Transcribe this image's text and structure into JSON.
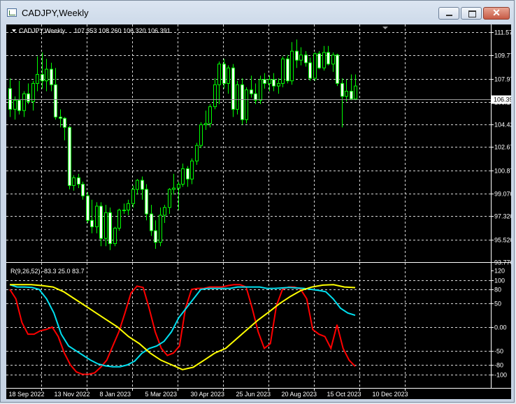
{
  "window": {
    "title": "CADJPY,Weekly",
    "close_glyph": "✕"
  },
  "main_header": {
    "symbol": "CADJPY,Weekly",
    "ohlc": "107.353 108.260 106.320 106.391"
  },
  "indicator_header": {
    "text": "R(9,26,52) -83.3 25.0 83.7"
  },
  "current_price": "106.391",
  "colors": {
    "candle": "#00ff00",
    "grid": "#d8d8d8",
    "background": "#000000",
    "red_line": "#ff0000",
    "yellow_line": "#ffff00",
    "cyan_line": "#00e0f0"
  },
  "icons": [
    "chart-window-icon",
    "minimize-icon",
    "maximize-icon",
    "close-icon",
    "dropdown-triangle-icon"
  ],
  "chart_data": [
    {
      "type": "candlestick",
      "y_ticks": [
        "111.570",
        "109.770",
        "107.970",
        "106.170",
        "104.420",
        "102.670",
        "100.870",
        "99.070",
        "97.320",
        "95.520",
        "93.770"
      ],
      "ylim": [
        93.77,
        111.57
      ],
      "x_ticks": [
        "18 Sep 2022",
        "13 Nov 2022",
        "8 Jan 2023",
        "5 Mar 2023",
        "30 Apr 2023",
        "25 Jun 2023",
        "20 Aug 2023",
        "15 Oct 2023",
        "10 Dec 2023"
      ],
      "grid": true,
      "candles": [
        [
          107.2,
          108.0,
          105.0,
          105.6
        ],
        [
          105.6,
          106.6,
          104.8,
          106.3
        ],
        [
          106.3,
          107.8,
          105.2,
          105.5
        ],
        [
          105.5,
          107.0,
          105.0,
          106.8
        ],
        [
          106.8,
          107.6,
          106.0,
          106.2
        ],
        [
          106.2,
          107.8,
          105.5,
          107.6
        ],
        [
          107.6,
          109.7,
          107.0,
          108.3
        ],
        [
          108.3,
          110.0,
          107.2,
          107.8
        ],
        [
          107.8,
          109.5,
          107.0,
          108.7
        ],
        [
          108.7,
          109.2,
          107.0,
          107.5
        ],
        [
          107.5,
          108.8,
          104.8,
          105.0
        ],
        [
          105.0,
          105.6,
          104.2,
          104.9
        ],
        [
          104.9,
          105.0,
          103.2,
          104.2
        ],
        [
          104.2,
          104.3,
          99.4,
          99.7
        ],
        [
          99.7,
          100.5,
          99.3,
          100.3
        ],
        [
          100.3,
          100.6,
          99.5,
          99.8
        ],
        [
          99.8,
          100.0,
          98.6,
          98.9
        ],
        [
          98.9,
          99.2,
          96.8,
          97.0
        ],
        [
          97.0,
          98.6,
          96.0,
          96.5
        ],
        [
          96.5,
          98.4,
          96.0,
          98.1
        ],
        [
          98.1,
          98.4,
          95.0,
          95.6
        ],
        [
          95.6,
          98.2,
          95.0,
          97.6
        ],
        [
          97.6,
          98.0,
          94.7,
          95.2
        ],
        [
          95.2,
          96.5,
          95.0,
          96.4
        ],
        [
          96.4,
          97.9,
          96.2,
          97.8
        ],
        [
          97.8,
          98.3,
          97.5,
          97.8
        ],
        [
          97.8,
          98.6,
          97.4,
          98.3
        ],
        [
          98.3,
          99.7,
          98.0,
          99.4
        ],
        [
          99.4,
          100.2,
          99.0,
          100.1
        ],
        [
          100.1,
          100.4,
          98.6,
          99.4
        ],
        [
          99.4,
          99.8,
          97.0,
          97.5
        ],
        [
          97.5,
          98.2,
          95.8,
          96.2
        ],
        [
          96.2,
          97.0,
          94.8,
          95.3
        ],
        [
          95.3,
          98.0,
          95.0,
          97.4
        ],
        [
          97.4,
          98.2,
          96.8,
          98.0
        ],
        [
          98.0,
          99.5,
          97.5,
          99.4
        ],
        [
          99.4,
          100.6,
          99.0,
          99.5
        ],
        [
          99.5,
          100.0,
          97.8,
          99.8
        ],
        [
          99.8,
          101.4,
          99.6,
          101.0
        ],
        [
          101.0,
          101.2,
          99.6,
          100.2
        ],
        [
          100.2,
          101.8,
          99.8,
          101.6
        ],
        [
          101.6,
          103.0,
          101.3,
          102.8
        ],
        [
          102.8,
          104.6,
          102.6,
          104.4
        ],
        [
          104.4,
          105.5,
          104.0,
          104.5
        ],
        [
          104.5,
          106.0,
          104.2,
          105.8
        ],
        [
          105.8,
          108.0,
          105.6,
          107.5
        ],
        [
          107.5,
          109.3,
          106.0,
          109.1
        ],
        [
          109.1,
          109.5,
          107.2,
          107.6
        ],
        [
          107.6,
          109.0,
          106.8,
          108.8
        ],
        [
          108.8,
          109.1,
          105.0,
          105.6
        ],
        [
          105.6,
          107.8,
          105.2,
          107.5
        ],
        [
          107.5,
          108.0,
          104.4,
          104.8
        ],
        [
          104.8,
          107.3,
          104.5,
          107.1
        ],
        [
          107.1,
          108.2,
          106.5,
          106.8
        ],
        [
          106.8,
          107.6,
          106.0,
          106.3
        ],
        [
          106.3,
          108.2,
          106.0,
          107.9
        ],
        [
          107.9,
          108.4,
          107.2,
          107.6
        ],
        [
          107.6,
          108.2,
          107.0,
          107.9
        ],
        [
          107.9,
          108.4,
          107.0,
          107.4
        ],
        [
          107.4,
          108.0,
          106.8,
          107.6
        ],
        [
          107.6,
          109.7,
          107.3,
          109.5
        ],
        [
          109.5,
          109.8,
          107.6,
          107.8
        ],
        [
          107.8,
          110.8,
          107.5,
          110.1
        ],
        [
          110.1,
          111.0,
          108.8,
          109.4
        ],
        [
          109.4,
          110.4,
          109.0,
          109.8
        ],
        [
          109.8,
          110.1,
          108.9,
          109.2
        ],
        [
          109.2,
          109.6,
          107.8,
          108.0
        ],
        [
          108.0,
          110.0,
          107.8,
          109.9
        ],
        [
          109.9,
          110.1,
          108.7,
          108.8
        ],
        [
          108.8,
          110.5,
          108.6,
          110.0
        ],
        [
          110.0,
          110.5,
          109.0,
          109.1
        ],
        [
          109.1,
          110.0,
          108.5,
          109.8
        ],
        [
          109.8,
          109.9,
          107.4,
          107.6
        ],
        [
          107.6,
          108.0,
          104.2,
          106.6
        ],
        [
          106.6,
          107.9,
          106.2,
          107.0
        ],
        [
          107.0,
          108.3,
          106.3,
          106.4
        ],
        [
          106.4,
          108.3,
          106.3,
          107.4
        ]
      ]
    },
    {
      "type": "line",
      "header": "R(9,26,52) -83.3 25.0 83.7",
      "y_ticks": [
        "120",
        "100",
        "80",
        "50",
        "0.00",
        "-50",
        "-80",
        "-100"
      ],
      "ylim": [
        -120,
        120
      ],
      "x_ticks": [
        "18 Sep 2022",
        "13 Nov 2022",
        "8 Jan 2023",
        "5 Mar 2023",
        "30 Apr 2023",
        "25 Jun 2023",
        "20 Aug 2023",
        "15 Oct 2023",
        "10 Dec 2023"
      ],
      "series": [
        {
          "color": "#ff0000",
          "values": [
            80,
            60,
            10,
            -15,
            -15,
            -8,
            -5,
            0,
            -20,
            -55,
            -80,
            -95,
            -100,
            -100,
            -97,
            -85,
            -70,
            -40,
            -10,
            30,
            72,
            87,
            84,
            40,
            -10,
            -45,
            -60,
            -55,
            -40,
            40,
            80,
            82,
            82,
            85,
            85,
            85,
            88,
            90,
            90,
            85,
            40,
            -10,
            -45,
            -35,
            45,
            80,
            85,
            85,
            80,
            60,
            -5,
            -15,
            -20,
            -45,
            5,
            -45,
            -70,
            -83.3
          ]
        },
        {
          "color": "#00e0f0",
          "values": [
            90,
            85,
            85,
            84,
            80,
            60,
            30,
            -15,
            -40,
            -50,
            -60,
            -70,
            -78,
            -82,
            -84,
            -84,
            -80,
            -72,
            -55,
            -45,
            -40,
            -30,
            -10,
            20,
            40,
            60,
            80,
            82,
            82,
            82,
            82,
            85,
            85,
            85,
            85,
            82,
            82,
            83,
            84,
            83,
            82,
            80,
            78,
            75,
            60,
            40,
            30,
            25
          ]
        },
        {
          "color": "#ffff00",
          "values": [
            90,
            90,
            90,
            88,
            85,
            75,
            60,
            45,
            30,
            15,
            0,
            -20,
            -35,
            -55,
            -70,
            -80,
            -90,
            -85,
            -70,
            -55,
            -45,
            -25,
            -5,
            15,
            32,
            50,
            65,
            78,
            85,
            89,
            90,
            85,
            83.7
          ]
        }
      ]
    }
  ]
}
